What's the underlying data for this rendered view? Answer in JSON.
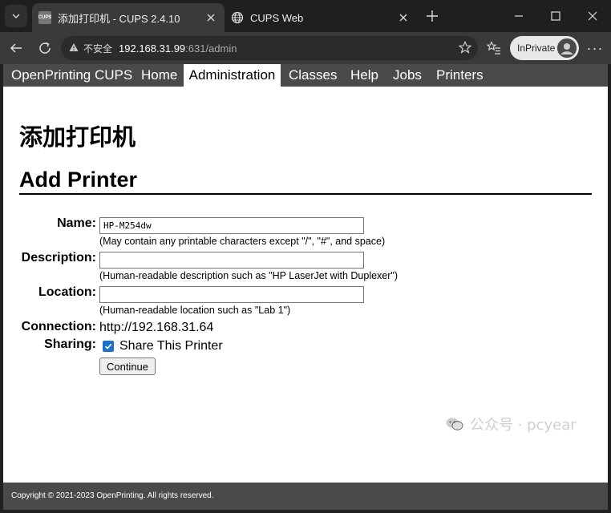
{
  "browser": {
    "tabs": [
      {
        "title": "添加打印机 - CUPS 2.4.10",
        "favicon": "cups-icon",
        "active": true
      },
      {
        "title": "CUPS Web",
        "favicon": "globe-icon",
        "active": false
      }
    ],
    "favicon_text": "CUPS",
    "address": {
      "security_label": "不安全",
      "host": "192.168.31.99",
      "path": ":631/admin"
    },
    "profile_label": "InPrivate"
  },
  "cups": {
    "nav": [
      {
        "label": "OpenPrinting CUPS",
        "active": false
      },
      {
        "label": "Home",
        "active": false
      },
      {
        "label": "Administration",
        "active": true
      },
      {
        "label": "Classes",
        "active": false
      },
      {
        "label": "Help",
        "active": false
      },
      {
        "label": "Jobs",
        "active": false
      },
      {
        "label": "Printers",
        "active": false
      }
    ],
    "heading_cn": "添加打印机",
    "heading_en": "Add Printer",
    "form": {
      "name_label": "Name:",
      "name_value": "HP-M254dw",
      "name_hint": "(May contain any printable characters except \"/\", \"#\", and space)",
      "description_label": "Description:",
      "description_value": "",
      "description_hint": "(Human-readable description such as \"HP LaserJet with Duplexer\")",
      "location_label": "Location:",
      "location_value": "",
      "location_hint": "(Human-readable location such as \"Lab 1\")",
      "connection_label": "Connection:",
      "connection_value": "http://192.168.31.64",
      "sharing_label": "Sharing:",
      "sharing_checked": true,
      "sharing_option": "Share This Printer",
      "continue_label": "Continue"
    },
    "footer": "Copyright © 2021-2023 OpenPrinting. All rights reserved."
  },
  "watermark": "公众号 · pcyear",
  "colors": {
    "chrome_dark": "#1f1f1f",
    "toolbar": "#3a3a3a",
    "cups_nav": "#4a4a4a",
    "checkbox": "#1a73c9"
  }
}
